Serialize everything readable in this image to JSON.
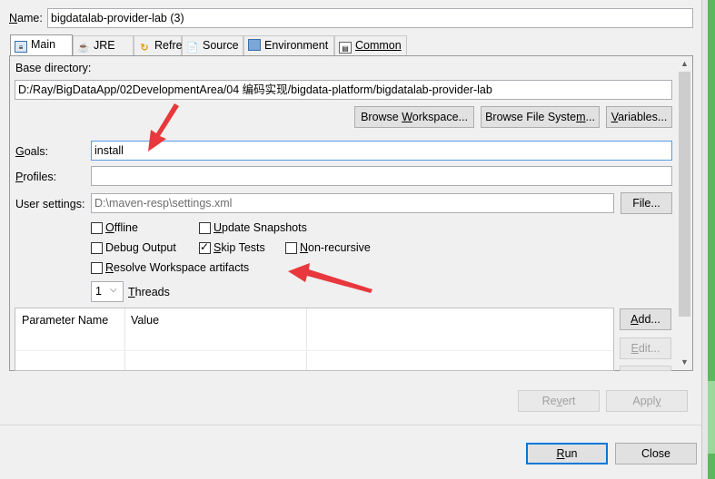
{
  "name": {
    "label_prefix": "",
    "label_mnemonic": "N",
    "label_rest": "ame:",
    "value": "bigdatalab-provider-lab (3)"
  },
  "tabs": [
    {
      "label": "Main",
      "icon": "main-icon"
    },
    {
      "label": "JRE",
      "icon": "jre-icon"
    },
    {
      "label": "Refresh",
      "icon": "refresh-icon"
    },
    {
      "label": "Source",
      "icon": "source-icon"
    },
    {
      "label": "Environment",
      "icon": "environment-icon"
    },
    {
      "label": "Common",
      "icon": "common-icon"
    }
  ],
  "main": {
    "base_dir_label": "Base directory:",
    "base_dir_value": "D:/Ray/BigDataApp/02DevelopmentArea/04 编码实现/bigdata-platform/bigdatalab-provider-lab",
    "browse_workspace": "Browse Workspace...",
    "browse_fs": "Browse File System...",
    "variables": "Variables...",
    "goals_label": "Goals:",
    "goals_value": "install",
    "profiles_label": "Profiles:",
    "profiles_value": "",
    "user_settings_label": "User settings:",
    "user_settings_value": "D:\\maven-resp\\settings.xml",
    "file_button": "File...",
    "checkboxes": {
      "offline": {
        "label": "Offline",
        "checked": false
      },
      "update_snapshots": {
        "label": "Update Snapshots",
        "checked": false
      },
      "debug_output": {
        "label": "Debug Output",
        "checked": false
      },
      "skip_tests": {
        "label": "Skip Tests",
        "checked": true
      },
      "non_recursive": {
        "label": "Non-recursive",
        "checked": false
      },
      "resolve_workspace": {
        "label": "Resolve Workspace artifacts",
        "checked": false
      }
    },
    "threads_value": "1",
    "threads_label": "Threads",
    "table": {
      "headers": [
        "Parameter Name",
        "Value"
      ]
    },
    "add": "Add...",
    "edit": "Edit..."
  },
  "footer": {
    "revert": "Revert",
    "apply": "Apply",
    "run": "Run",
    "close": "Close"
  },
  "colors": {
    "annotation_arrow": "#e8383d",
    "focus_border": "#569de5",
    "right_strip": "#5cb85c"
  }
}
